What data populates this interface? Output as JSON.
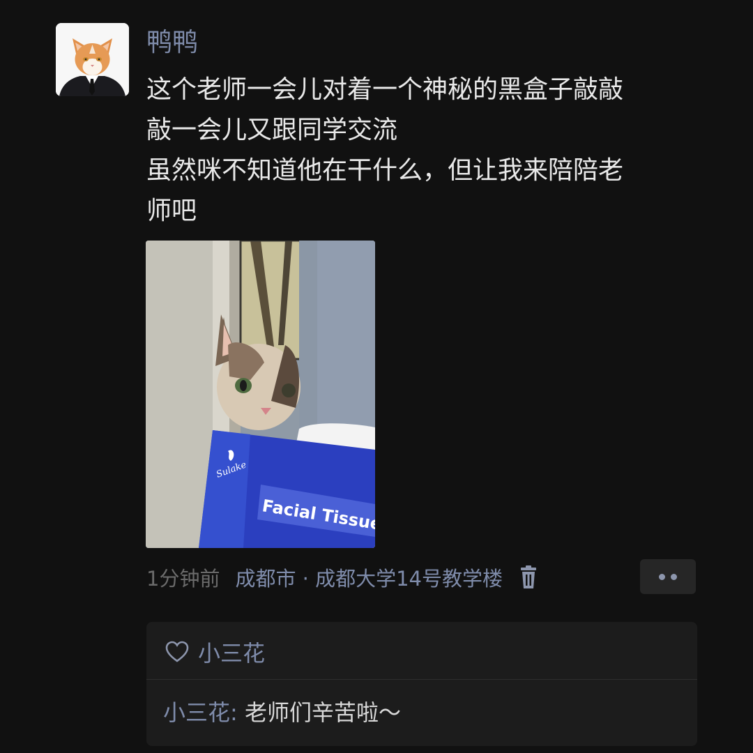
{
  "post": {
    "author": "鸭鸭",
    "lines": [
      "这个老师一会儿对着一个神秘的黑盒子敲敲",
      "敲一会儿又跟同学交流",
      "虽然咪不知道他在干什么，但让我来陪陪老",
      "师吧"
    ],
    "photo": {
      "box_text": "Facial Tissue",
      "brand_text": "Sulake"
    },
    "time": "1分钟前",
    "location": "成都市 · 成都大学14号教学楼"
  },
  "interactions": {
    "likes": [
      "小三花"
    ],
    "comments": [
      {
        "author": "小三花",
        "separator": ": ",
        "text": "老师们辛苦啦～"
      }
    ]
  },
  "icons": {
    "delete": "trash-icon",
    "more": "more-dots-icon",
    "like": "heart-outline-icon"
  },
  "colors": {
    "background": "#111111",
    "link": "#7f8cab",
    "text": "#e9e9e9",
    "muted": "#6b6b6b",
    "panel": "#1c1c1c"
  }
}
